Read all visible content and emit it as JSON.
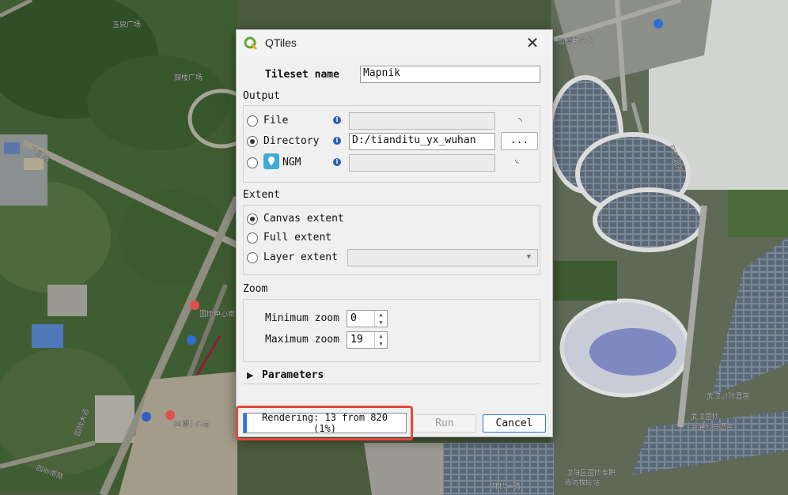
{
  "map": {
    "labels": [
      "玉泉广场",
      "鼓楼广场",
      "国博中心北",
      "文教路",
      "国博中心南",
      "国博中心南",
      "四新南路",
      "国博大道",
      "武汉洲际酒店",
      "武汉国博",
      "会展假日酒店",
      "汉阳区国博专职",
      "消防救援站",
      "环博一路",
      "环博北路"
    ]
  },
  "dialog": {
    "title": "QTiles",
    "tileset_label": "Tileset name",
    "tileset_value": "Mapnik",
    "output_label": "Output",
    "output_options": [
      {
        "label": "File",
        "value": "",
        "checked": false
      },
      {
        "label": "Directory",
        "value": "D:/tianditu_yx_wuhan",
        "checked": true
      },
      {
        "label": "NGM",
        "value": "",
        "checked": false
      }
    ],
    "browse_label": "...",
    "extent_label": "Extent",
    "extent_options": [
      {
        "label": "Canvas extent",
        "checked": true
      },
      {
        "label": "Full extent",
        "checked": false
      },
      {
        "label": "Layer extent",
        "checked": false
      }
    ],
    "zoom_label": "Zoom",
    "min_zoom_label": "Minimum zoom",
    "min_zoom_value": "0",
    "max_zoom_label": "Maximum zoom",
    "max_zoom_value": "19",
    "parameters_label": "Parameters",
    "progress_text_line1": "Rendering: 13 from 820",
    "progress_text_line2": "(1%)",
    "progress_value": 0.01,
    "run_label": "Run",
    "cancel_label": "Cancel"
  }
}
